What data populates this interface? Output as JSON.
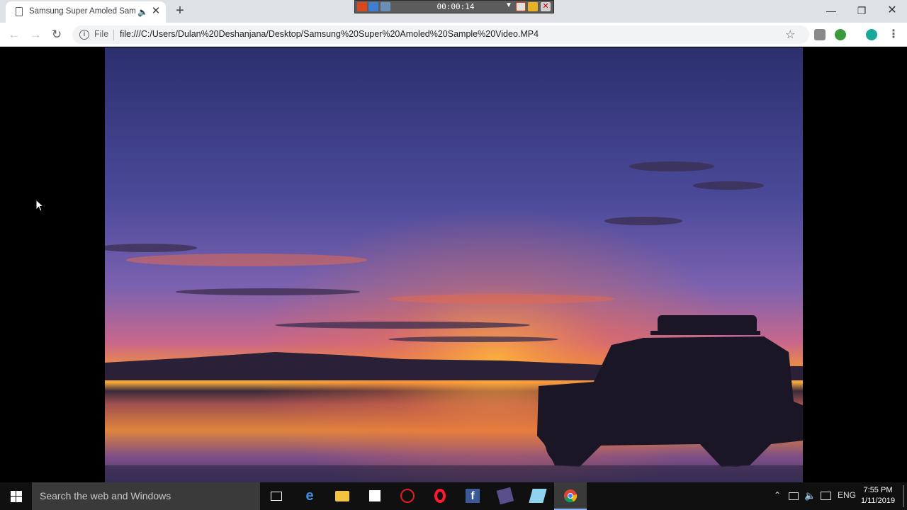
{
  "browser": {
    "tab": {
      "title": "Samsung Super Amoled Sam"
    },
    "new_tab_label": "+",
    "address": {
      "security_chip": "File",
      "url": "file:///C:/Users/Dulan%20Deshanjana/Desktop/Samsung%20Super%20Amoled%20Sample%20Video.MP4"
    }
  },
  "recorder": {
    "time": "00:00:14"
  },
  "taskbar": {
    "search_placeholder": "Search the web and Windows",
    "language": "ENG",
    "clock_time": "7:55 PM",
    "clock_date": "1/11/2019",
    "pinned": [
      "task-view",
      "edge",
      "file-explorer",
      "store",
      "app-red",
      "opera",
      "facebook",
      "video-editor",
      "app-blue",
      "chrome"
    ]
  },
  "colors": {
    "taskbar": "#101010",
    "search_box": "#3a3a3a",
    "tabstrip": "#dee1e6",
    "omnibox": "#f1f3f4"
  }
}
